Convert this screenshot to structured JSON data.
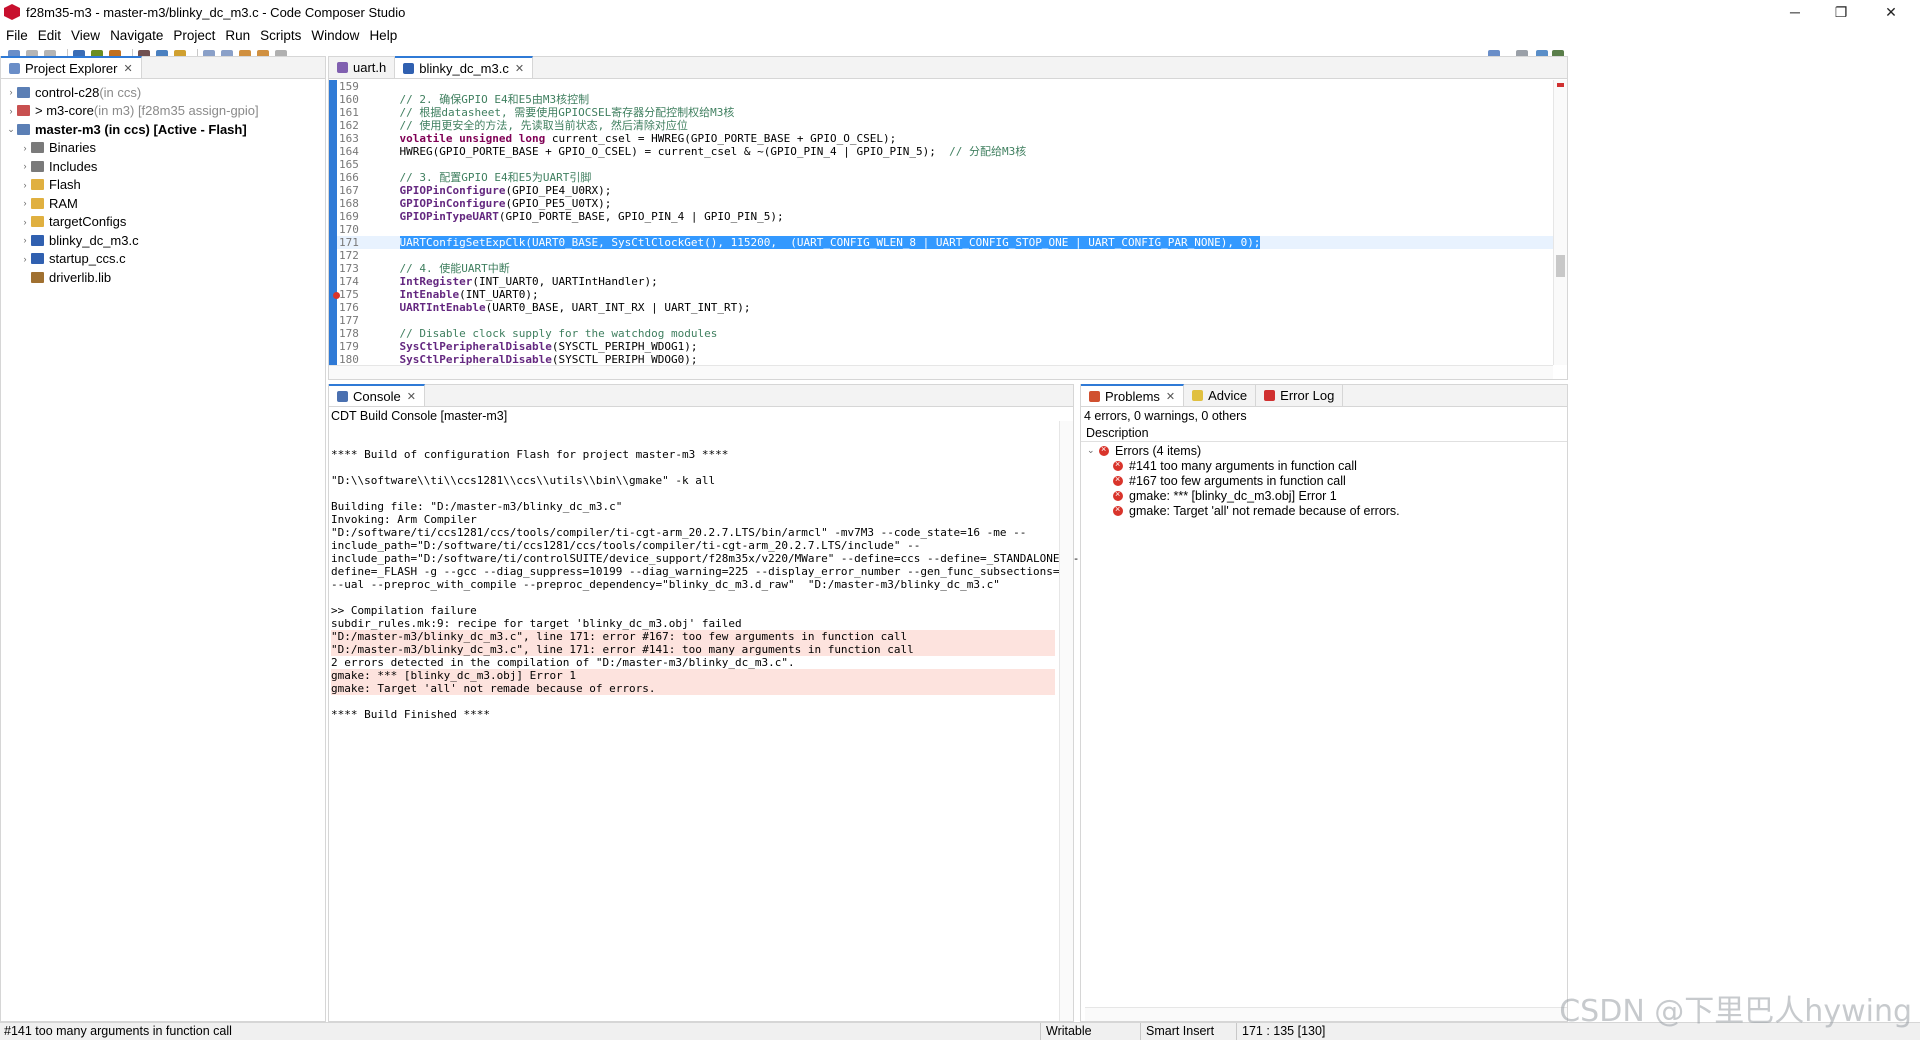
{
  "window": {
    "title": "f28m35-m3 - master-m3/blinky_dc_m3.c - Code Composer Studio",
    "controls": {
      "minimize": "─",
      "maximize": "❐",
      "close": "✕"
    }
  },
  "menu": [
    "File",
    "Edit",
    "View",
    "Navigate",
    "Project",
    "Run",
    "Scripts",
    "Window",
    "Help"
  ],
  "project_explorer": {
    "tab_label": "Project Explorer",
    "items": [
      {
        "name": "control-c28",
        "suffix": " (in ccs)",
        "expander": "›",
        "icon_color": "#5b7fb5"
      },
      {
        "name": "> m3-core",
        "suffix": " (in m3) [f28m35 assign-gpio]",
        "expander": "›",
        "icon_color": "#c85050"
      },
      {
        "name": "master-m3 (in ccs)  [Active - Flash]",
        "suffix": "",
        "expander": "⌄",
        "icon_color": "#5b7fb5"
      },
      {
        "name": "Binaries",
        "expander": "›",
        "icon_color": "#7a7a7a"
      },
      {
        "name": "Includes",
        "expander": "›",
        "icon_color": "#7a7a7a"
      },
      {
        "name": "Flash",
        "expander": "›",
        "icon_color": "#e0b040"
      },
      {
        "name": "RAM",
        "expander": "›",
        "icon_color": "#e0b040"
      },
      {
        "name": "targetConfigs",
        "expander": "›",
        "icon_color": "#e0b040"
      },
      {
        "name": "blinky_dc_m3.c",
        "expander": "›",
        "icon_color": "#3060b0"
      },
      {
        "name": "startup_ccs.c",
        "expander": "›",
        "icon_color": "#3060b0"
      },
      {
        "name": "driverlib.lib",
        "expander": "",
        "icon_color": "#a07030"
      }
    ]
  },
  "editor": {
    "tabs": [
      {
        "label": "uart.h",
        "active": false
      },
      {
        "label": "blinky_dc_m3.c",
        "active": true
      }
    ],
    "lines": [
      {
        "n": "159",
        "t": ""
      },
      {
        "n": "160",
        "t": "    // 2. 确保GPIO E4和E5由M3核控制",
        "c": "cmt"
      },
      {
        "n": "161",
        "t": "    // 根据datasheet, 需要使用GPIOCSEL寄存器分配控制权给M3核",
        "c": "cmt"
      },
      {
        "n": "162",
        "t": "    // 使用更安全的方法, 先读取当前状态, 然后清除对应位",
        "c": "cmt"
      },
      {
        "n": "163",
        "t": "    volatile unsigned long current_csel = HWREG(GPIO_PORTE_BASE + GPIO_O_CSEL);",
        "c": ""
      },
      {
        "n": "164",
        "t": "    HWREG(GPIO_PORTE_BASE + GPIO_O_CSEL) = current_csel & ~(GPIO_PIN_4 | GPIO_PIN_5);  // 分配给M3核",
        "c": ""
      },
      {
        "n": "165",
        "t": ""
      },
      {
        "n": "166",
        "t": "    // 3. 配置GPIO E4和E5为UART引脚",
        "c": "cmt"
      },
      {
        "n": "167",
        "t": "    GPIOPinConfigure(GPIO_PE4_U0RX);",
        "c": ""
      },
      {
        "n": "168",
        "t": "    GPIOPinConfigure(GPIO_PE5_U0TX);",
        "c": ""
      },
      {
        "n": "169",
        "t": "    GPIOPinTypeUART(GPIO_PORTE_BASE, GPIO_PIN_4 | GPIO_PIN_5);",
        "c": ""
      },
      {
        "n": "170",
        "t": ""
      },
      {
        "n": "171",
        "t": "    UARTConfigSetExpClk(UART0_BASE, SysCtlClockGet(), 115200,  (UART_CONFIG_WLEN_8 | UART_CONFIG_STOP_ONE | UART_CONFIG_PAR_NONE), 0);",
        "c": "sel"
      },
      {
        "n": "172",
        "t": ""
      },
      {
        "n": "173",
        "t": "    // 4. 使能UART中断",
        "c": "cmt"
      },
      {
        "n": "174",
        "t": "    IntRegister(INT_UART0, UARTIntHandler);",
        "c": ""
      },
      {
        "n": "175",
        "t": "    IntEnable(INT_UART0);",
        "c": ""
      },
      {
        "n": "176",
        "t": "    UARTIntEnable(UART0_BASE, UART_INT_RX | UART_INT_RT);",
        "c": ""
      },
      {
        "n": "177",
        "t": ""
      },
      {
        "n": "178",
        "t": "    // Disable clock supply for the watchdog modules",
        "c": "cmt"
      },
      {
        "n": "179",
        "t": "    SysCtlPeripheralDisable(SYSCTL_PERIPH_WDOG1);",
        "c": ""
      },
      {
        "n": "180",
        "t": "    SysCtlPeripheralDisable(SYSCTL_PERIPH_WDOG0);",
        "c": ""
      }
    ]
  },
  "console": {
    "tab_label": "Console",
    "subtitle": "CDT Build Console [master-m3]",
    "lines": [
      {
        "t": "",
        "err": false
      },
      {
        "t": "**** Build of configuration Flash for project master-m3 ****",
        "err": false
      },
      {
        "t": "",
        "err": false
      },
      {
        "t": "\"D:\\\\software\\\\ti\\\\ccs1281\\\\ccs\\\\utils\\\\bin\\\\gmake\" -k all",
        "err": false
      },
      {
        "t": "",
        "err": false
      },
      {
        "t": "Building file: \"D:/master-m3/blinky_dc_m3.c\"",
        "err": false
      },
      {
        "t": "Invoking: Arm Compiler",
        "err": false
      },
      {
        "t": "\"D:/software/ti/ccs1281/ccs/tools/compiler/ti-cgt-arm_20.2.7.LTS/bin/armcl\" -mv7M3 --code_state=16 -me --",
        "err": false
      },
      {
        "t": "include_path=\"D:/software/ti/ccs1281/ccs/tools/compiler/ti-cgt-arm_20.2.7.LTS/include\" --",
        "err": false
      },
      {
        "t": "include_path=\"D:/software/ti/controlSUITE/device_support/f28m35x/v220/MWare\" --define=ccs --define=_STANDALONE --",
        "err": false
      },
      {
        "t": "define=_FLASH -g --gcc --diag_suppress=10199 --diag_warning=225 --display_error_number --gen_func_subsections=on --abi=eabi",
        "err": false
      },
      {
        "t": "--ual --preproc_with_compile --preproc_dependency=\"blinky_dc_m3.d_raw\"  \"D:/master-m3/blinky_dc_m3.c\"",
        "err": false
      },
      {
        "t": "",
        "err": false
      },
      {
        "t": ">> Compilation failure",
        "err": false
      },
      {
        "t": "subdir_rules.mk:9: recipe for target 'blinky_dc_m3.obj' failed",
        "err": false
      },
      {
        "t": "\"D:/master-m3/blinky_dc_m3.c\", line 171: error #167: too few arguments in function call",
        "err": true
      },
      {
        "t": "\"D:/master-m3/blinky_dc_m3.c\", line 171: error #141: too many arguments in function call",
        "err": true
      },
      {
        "t": "2 errors detected in the compilation of \"D:/master-m3/blinky_dc_m3.c\".",
        "err": false
      },
      {
        "t": "gmake: *** [blinky_dc_m3.obj] Error 1",
        "err": true
      },
      {
        "t": "gmake: Target 'all' not remade because of errors.",
        "err": true
      },
      {
        "t": "",
        "err": false
      },
      {
        "t": "**** Build Finished ****",
        "err": false
      }
    ]
  },
  "problems": {
    "tabs": [
      "Problems",
      "Advice",
      "Error Log"
    ],
    "summary": "4 errors, 0 warnings, 0 others",
    "column_header": "Description",
    "group_label": "Errors (4 items)",
    "items": [
      "#141 too many arguments in function call",
      "#167 too few arguments in function call",
      "gmake: *** [blinky_dc_m3.obj] Error 1",
      "gmake: Target 'all' not remade because of errors."
    ]
  },
  "statusbar": {
    "message": "#141 too many arguments in function call",
    "mode": "Writable",
    "insert": "Smart Insert",
    "position": "171 : 135 [130]"
  },
  "watermark": "CSDN @下里巴人hywing"
}
